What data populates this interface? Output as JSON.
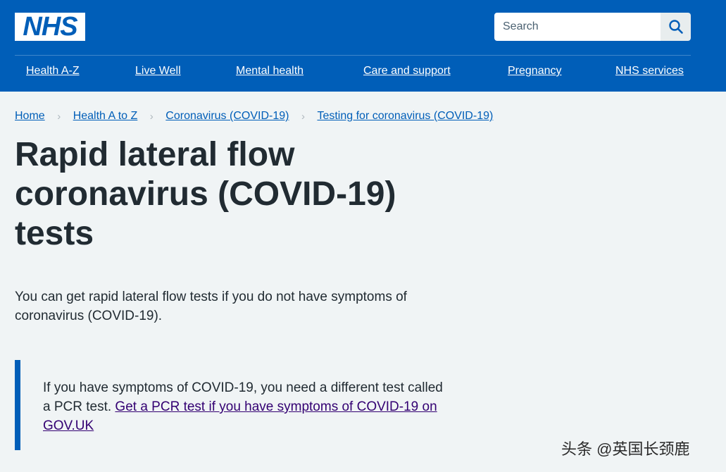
{
  "header": {
    "logo_text": "NHS",
    "search": {
      "placeholder": "Search",
      "value": "",
      "button_icon": "search-icon"
    },
    "nav": [
      {
        "label": "Health A-Z"
      },
      {
        "label": "Live Well"
      },
      {
        "label": "Mental health"
      },
      {
        "label": "Care and support"
      },
      {
        "label": "Pregnancy"
      },
      {
        "label": "NHS services"
      }
    ]
  },
  "breadcrumb": [
    {
      "label": "Home"
    },
    {
      "label": "Health A to Z"
    },
    {
      "label": "Coronavirus (COVID-19)"
    },
    {
      "label": "Testing for coronavirus (COVID-19)"
    }
  ],
  "main": {
    "title": "Rapid lateral flow coronavirus (COVID-19) tests",
    "lead": "You can get rapid lateral flow tests if you do not have symptoms of coronavirus (COVID-19).",
    "inset": {
      "text": "If you have symptoms of COVID-19, you need a different test called a PCR test. ",
      "link_label": "Get a PCR test if you have symptoms of COVID-19 on GOV.UK"
    }
  },
  "watermark": "头条 @英国长颈鹿",
  "colors": {
    "brand_blue": "#005eb8",
    "page_background": "#f0f4f5",
    "text": "#212b32",
    "visited_link": "#330072"
  }
}
